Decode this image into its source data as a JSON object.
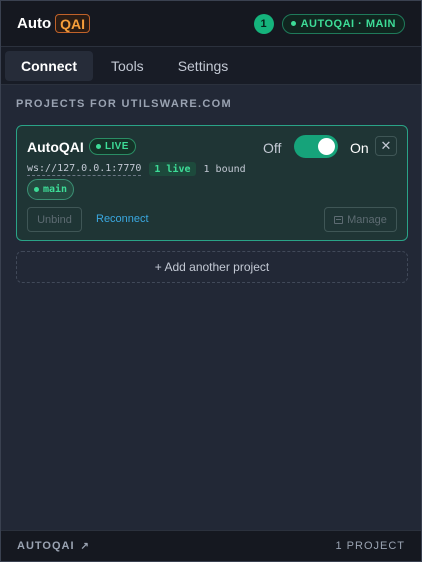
{
  "header": {
    "logo_part1": "Auto",
    "logo_part2": "QAI",
    "count": "1",
    "project_pill": "AUTOQAI · MAIN"
  },
  "tabs": [
    {
      "label": "Connect",
      "active": true
    },
    {
      "label": "Tools",
      "active": false
    },
    {
      "label": "Settings",
      "active": false
    }
  ],
  "section_title": "PROJECTS FOR UTILSWARE.COM",
  "project": {
    "name": "AutoQAI",
    "status": "LIVE",
    "toggle_off_label": "Off",
    "toggle_on_label": "On",
    "toggle_state": "on",
    "close_glyph": "✕",
    "ws_url": "ws://127.0.0.1:7770",
    "live_count": "1 live",
    "bound": "1 bound",
    "branch": "main",
    "unbind_label": "Unbind",
    "reconnect_label": "Reconnect",
    "manage_label": "Manage"
  },
  "add_project_label": "+ Add another project",
  "footer": {
    "link_label": "AUTOQAI",
    "link_glyph": "↗",
    "project_count": "1 PROJECT"
  },
  "colors": {
    "accent_green": "#3ddc97",
    "toggle_green": "#16a37a",
    "link_blue": "#3aa8e0",
    "logo_orange": "#f59e3a"
  }
}
